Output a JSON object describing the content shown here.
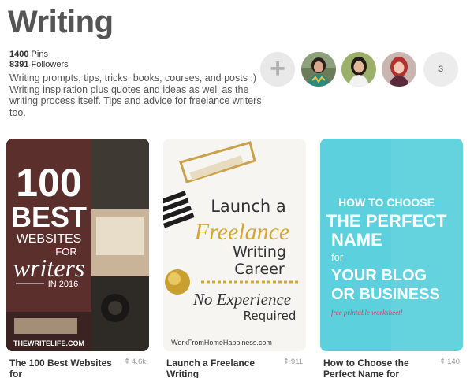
{
  "board": {
    "title": "Writing",
    "pins_count": "1400",
    "pins_label": "Pins",
    "followers_count": "8391",
    "followers_label": "Followers",
    "description": "Writing prompts, tips, tricks, books, courses, and posts :) Writing inspiration plus quotes and ideas as well as the writing process itself. Tips and advice for freelance writers too."
  },
  "collaborators": {
    "add_label": "+",
    "more_count": "3"
  },
  "pins": [
    {
      "title": "The 100 Best Websites for",
      "saves": "4.6k",
      "image_text": {
        "line1": "100",
        "line2": "BEST",
        "line3": "WEBSITES",
        "line4": "FOR",
        "line5": "writers",
        "line6": "IN 2016",
        "source": "THEWRITELIFE.COM"
      }
    },
    {
      "title": "Launch a Freelance Writing",
      "saves": "911",
      "image_text": {
        "line1": "Launch a",
        "line2": "Freelance",
        "line3": "Writing",
        "line4": "Career",
        "line5": "No Experience",
        "line6": "Required",
        "source": "WorkFromHomeHappiness.com"
      }
    },
    {
      "title": "How to Choose the Perfect Name for",
      "saves": "140",
      "image_text": {
        "line1": "HOW TO CHOOSE",
        "line2": "THE PERFECT",
        "line3": "NAME",
        "line4": "for",
        "line5": "YOUR BLOG",
        "line6": "OR BUSINESS",
        "source": "free printable worksheet!"
      }
    }
  ],
  "icons": {
    "pin": "pushpin-icon",
    "add": "plus-icon"
  },
  "colors": {
    "pin3_bg": "#5cd0dc",
    "pin1_bg": "#5a2e2a"
  }
}
